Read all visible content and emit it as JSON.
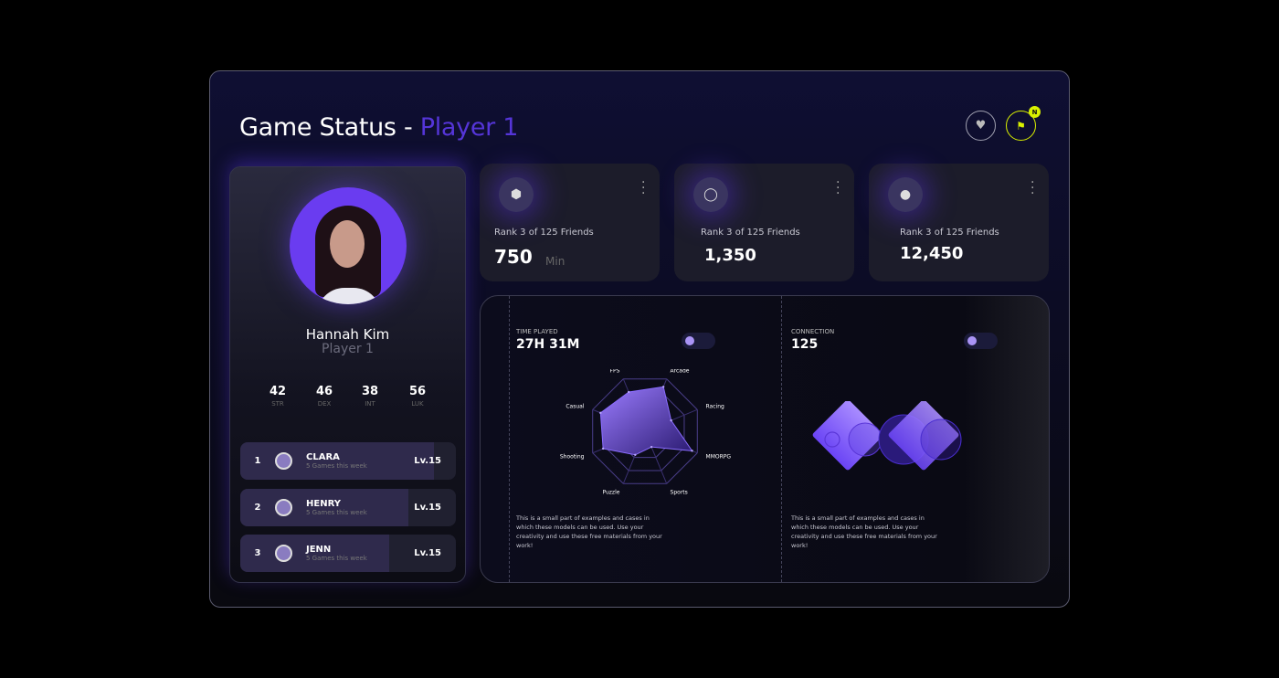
{
  "header": {
    "title_main": "Game Status - ",
    "title_player": "Player 1",
    "badge": "N"
  },
  "icons": {
    "heart": "heart-icon",
    "flag": "flag-icon"
  },
  "profile": {
    "name": "Hannah Kim",
    "subtitle": "Player 1",
    "stats": [
      {
        "value": "42",
        "label": "STR"
      },
      {
        "value": "46",
        "label": "DEX"
      },
      {
        "value": "38",
        "label": "INT"
      },
      {
        "value": "56",
        "label": "LUK"
      }
    ]
  },
  "leaderboard": [
    {
      "rank": "1",
      "name": "CLARA",
      "games": "5 Games this week",
      "level": "Lv.15",
      "progress": 0.9
    },
    {
      "rank": "2",
      "name": "HENRY",
      "games": "5 Games this week",
      "level": "Lv.15",
      "progress": 0.78
    },
    {
      "rank": "3",
      "name": "JENN",
      "games": "5 Games this week",
      "level": "Lv.15",
      "progress": 0.69
    }
  ],
  "cards": [
    {
      "rank": "Rank 3 of 125 Friends",
      "value": "750",
      "unit": "Min",
      "icon": "gem-icon"
    },
    {
      "rank": "Rank 3 of 125 Friends",
      "value": "1,350",
      "unit": "",
      "icon": "ring-icon"
    },
    {
      "rank": "Rank 3 of 125 Friends",
      "value": "12,450",
      "unit": "",
      "icon": "orb-icon"
    }
  ],
  "time_played": {
    "label": "TIME PLAYED",
    "value": "27H 31M",
    "toggle_on": false,
    "description": "This is a small part of examples and cases in which these models can be used. Use your creativity and use these free materials from your work!"
  },
  "connection": {
    "label": "CONNECTION",
    "value": "125",
    "toggle_on": false,
    "description": "This is a small part of examples and cases in which these models can be used. Use your creativity and use these free materials from your work!"
  },
  "chart_data": {
    "type": "radar",
    "categories": [
      "FPS",
      "Arcade",
      "Racing",
      "MMORPG",
      "Sports",
      "Puzzle",
      "Shooting",
      "Casual"
    ],
    "values": [
      0.75,
      0.85,
      0.5,
      0.9,
      0.3,
      0.45,
      0.8,
      0.85
    ],
    "rlim": [
      0,
      1
    ],
    "grid": true
  },
  "colors": {
    "accent": "#5535d8",
    "highlight": "#d9f000",
    "radar": "#7b5cf5"
  }
}
